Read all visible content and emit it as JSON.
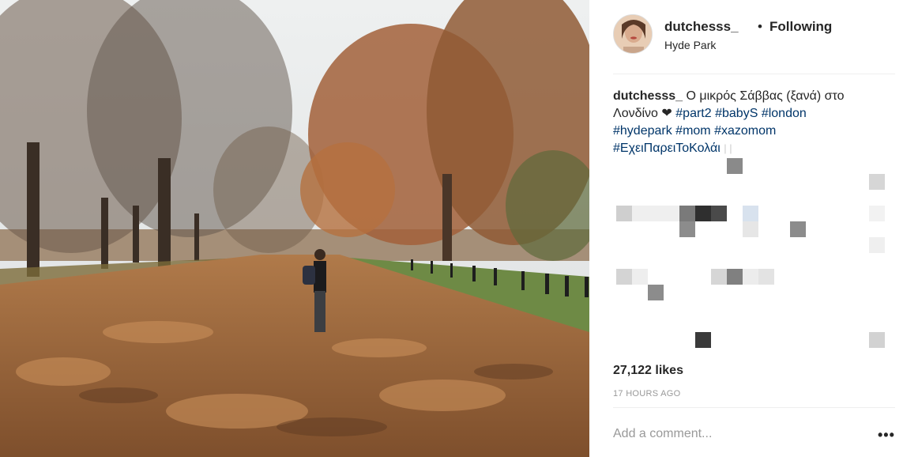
{
  "post": {
    "username": "dutchesss_",
    "separator": "•",
    "follow_status": "Following",
    "location": "Hyde Park",
    "caption": {
      "username": "dutchesss_",
      "text": "Ο μικρός Σάββας (ξανά) στο Λονδίνο",
      "heart": "❤",
      "hashtags": [
        "#part2",
        "#babyS",
        "#london",
        "#hydepark",
        "#mom",
        "#xazomom",
        "#ΕχειΠαρειΤοΚολάι"
      ],
      "trailing_glyphs": "| |"
    },
    "likes": "27,122 likes",
    "timestamp": "17 HOURS AGO",
    "comment_placeholder": "Add a comment...",
    "more_options": "•••"
  },
  "colors": {
    "hashtag": "#003569",
    "muted": "#999999",
    "text": "#262626"
  },
  "icons": {
    "avatar": "profile-avatar",
    "heart": "heart-glyph",
    "more": "more-options-icon"
  }
}
